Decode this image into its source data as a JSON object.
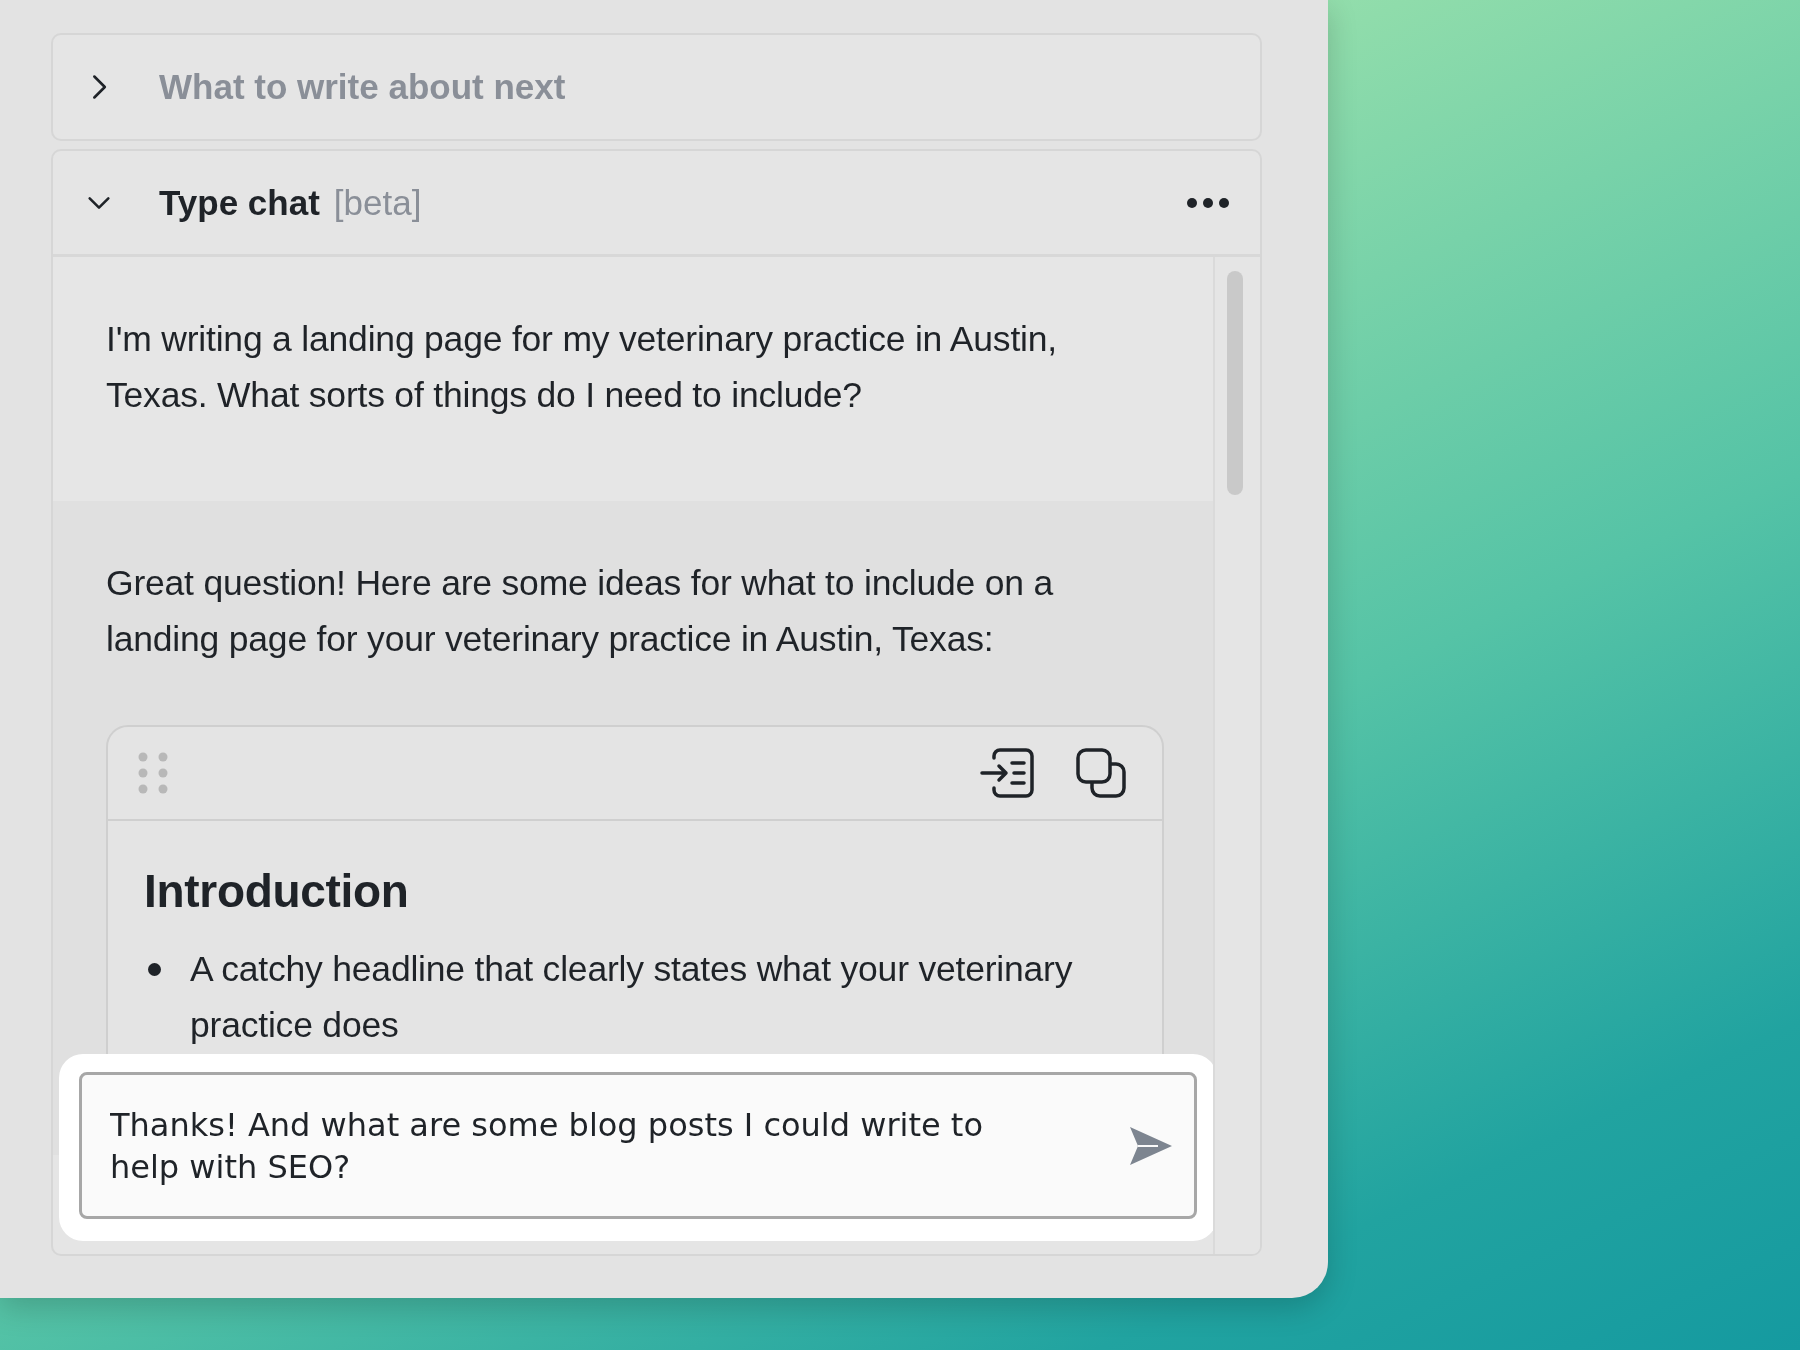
{
  "sections": [
    {
      "title": "What to write about next",
      "expanded": false
    },
    {
      "title": "Type chat",
      "tag": "[beta]",
      "expanded": true,
      "messages": [
        {
          "kind": "user",
          "text": "I'm writing a landing page for my veterinary practice in Austin, Texas. What sorts of things do I need to include?"
        },
        {
          "kind": "assistant",
          "text": "Great question! Here are some ideas for what to include on a landing page for your veterinary practice in Austin, Texas:",
          "block": {
            "heading": "Introduction",
            "bullets": [
              "A catchy headline that clearly states what your veterinary practice does"
            ]
          }
        }
      ],
      "composer": {
        "value": "Thanks! And what are some blog posts I could write to help with SEO?"
      }
    }
  ]
}
